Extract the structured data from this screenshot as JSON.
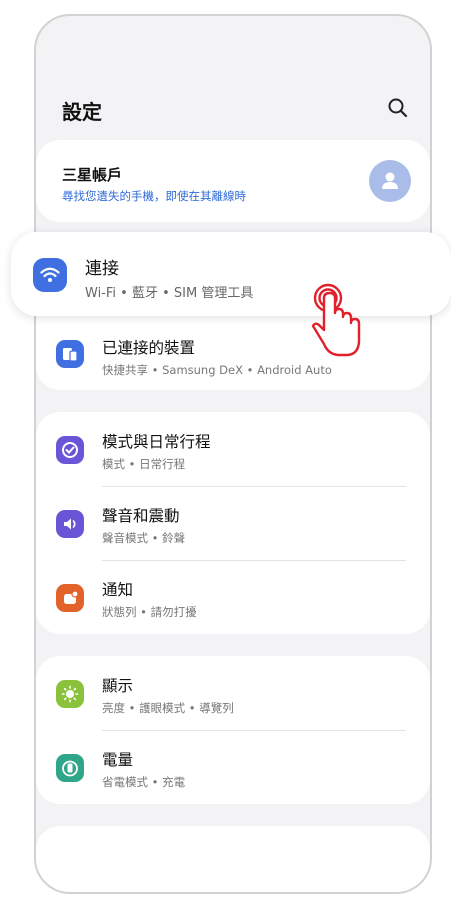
{
  "header": {
    "title": "設定",
    "search_icon": "search-icon"
  },
  "account": {
    "title": "三星帳戶",
    "subtitle": "尋找您遺失的手機，即使在其離線時",
    "avatar_icon": "person-icon"
  },
  "connections": {
    "title": "連接",
    "subtitle": "Wi-Fi • 藍牙 • SIM 管理工具",
    "icon": "wifi-icon",
    "color": "#3f6fe0"
  },
  "connected_devices": {
    "title": "已連接的裝置",
    "subtitle": "快捷共享 • Samsung DeX • Android Auto",
    "icon": "devices-icon",
    "color": "#3f6fe0"
  },
  "group2": [
    {
      "title": "模式與日常行程",
      "subtitle": "模式 • 日常行程",
      "icon": "modes-icon",
      "color": "#6a55d6"
    },
    {
      "title": "聲音和震動",
      "subtitle": "聲音模式 • 鈴聲",
      "icon": "volume-icon",
      "color": "#6a55d6"
    },
    {
      "title": "通知",
      "subtitle": "狀態列 • 請勿打擾",
      "icon": "notification-icon",
      "color": "#e2622a"
    }
  ],
  "group3": [
    {
      "title": "顯示",
      "subtitle": "亮度 • 護眼模式 • 導覽列",
      "icon": "sun-icon",
      "color": "#8ac33b"
    },
    {
      "title": "電量",
      "subtitle": "省電模式 • 充電",
      "icon": "battery-icon",
      "color": "#2fa58a"
    }
  ],
  "tap_indicator_icon": "tap-hand-icon"
}
